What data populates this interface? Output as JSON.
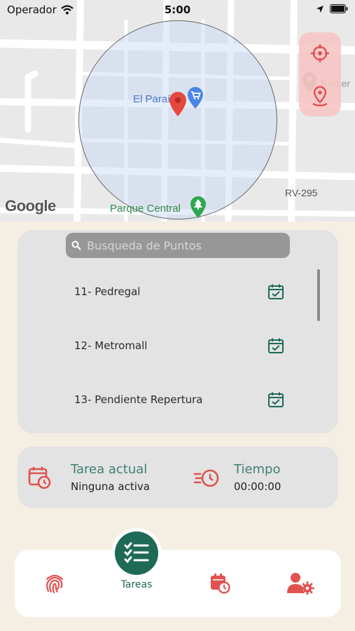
{
  "status_bar": {
    "carrier": "Operador",
    "time": "5:00",
    "icons": [
      "wifi-icon",
      "location-arrow-icon",
      "battery-icon"
    ]
  },
  "map": {
    "labels": {
      "poi_store": "El Paraíso",
      "poi_park": "Parque Central",
      "road": "RV-295",
      "poi_right": "Barber"
    },
    "logo_text": "Google",
    "controls": [
      "crosshair-icon",
      "location-pin-icon"
    ]
  },
  "search": {
    "placeholder": "Busqueda de Puntos",
    "value": ""
  },
  "points": [
    {
      "label": "11- Pedregal",
      "icon": "calendar-check-icon"
    },
    {
      "label": "12- Metromall",
      "icon": "calendar-check-icon"
    },
    {
      "label": "13- Pendiente Repertura",
      "icon": "calendar-check-icon"
    }
  ],
  "current_task": {
    "title": "Tarea actual",
    "value": "Ninguna activa",
    "time_title": "Tiempo",
    "time_value": "00:00:00"
  },
  "nav": {
    "items": [
      {
        "icon": "fingerprint-icon"
      },
      {
        "icon": "tasks-list-icon",
        "label": "Tareas",
        "active": true
      },
      {
        "icon": "calendar-clock-icon"
      },
      {
        "icon": "user-settings-icon"
      }
    ]
  },
  "colors": {
    "accent_green": "#1e6a57",
    "accent_red": "#e0524f",
    "background": "#f5efe3",
    "card": "#e3e3e3"
  }
}
